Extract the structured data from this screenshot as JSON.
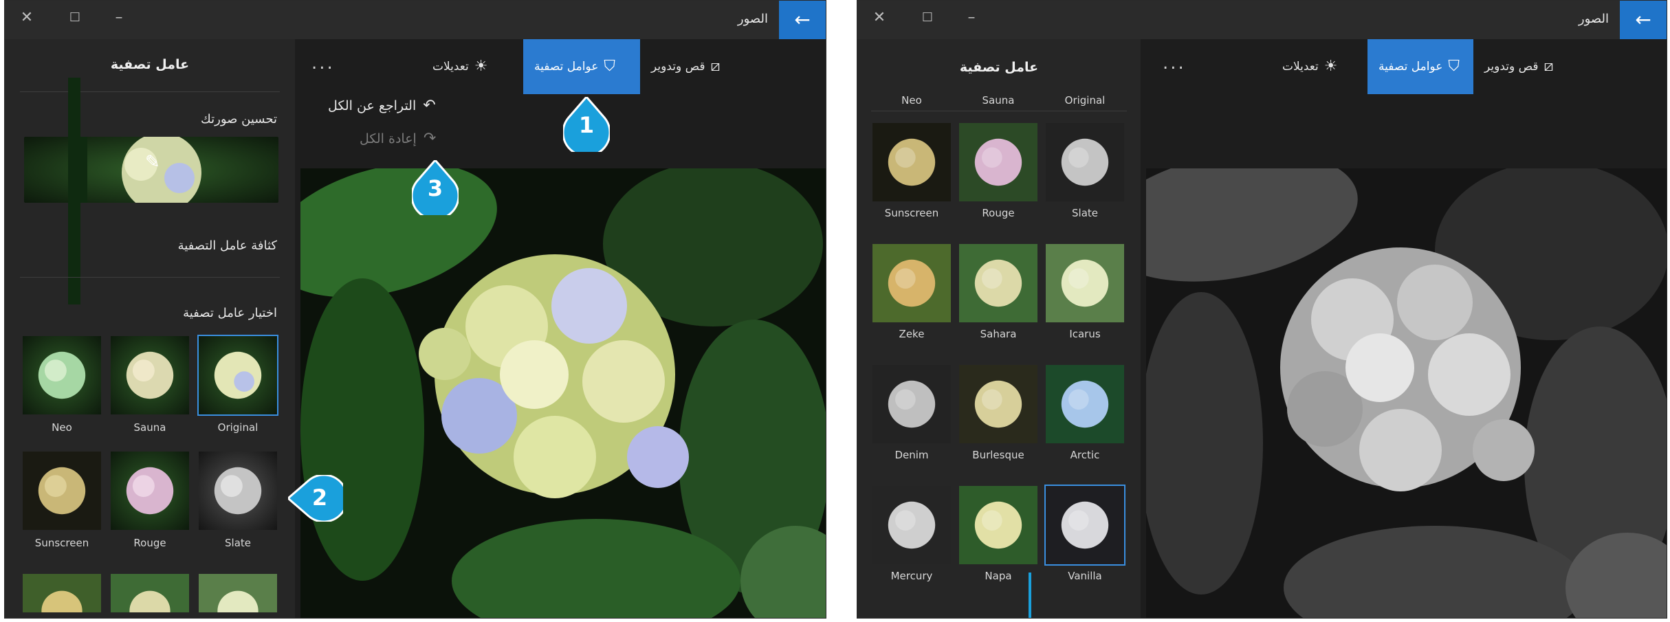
{
  "windowA": {
    "title": "الصور",
    "back_icon": "back-arrow-icon",
    "toolbar": {
      "crop_label": "قص وتدوير",
      "filters_label": "عوامل تصفية",
      "adjust_label": "تعديلات",
      "more_label": "..."
    },
    "undo_all": "التراجع عن الكل",
    "redo_all": "إعادة الكل",
    "panel": {
      "title": "عامل تصفية",
      "enhance_label": "تحسين صورتك",
      "intensity_label": "كثافة عامل التصفية",
      "choose_label": "اختيار عامل تصفية",
      "filters_row1": [
        "Neo",
        "Sauna",
        "Original"
      ],
      "filters_row2": [
        "Sunscreen",
        "Rouge",
        "Slate"
      ],
      "selected": "Original"
    },
    "callouts": [
      "1",
      "2",
      "3"
    ]
  },
  "windowB": {
    "title": "الصور",
    "back_icon": "back-arrow-icon",
    "toolbar": {
      "crop_label": "قص وتدوير",
      "filters_label": "عوامل تصفية",
      "adjust_label": "تعديلات",
      "more_label": "..."
    },
    "panel": {
      "title": "عامل تصفية",
      "header_row": [
        "Neo",
        "Sauna",
        "Original"
      ],
      "filters_row1": [
        "Sunscreen",
        "Rouge",
        "Slate"
      ],
      "filters_row2": [
        "Zeke",
        "Sahara",
        "Icarus"
      ],
      "filters_row3": [
        "Denim",
        "Burlesque",
        "Arctic"
      ],
      "filters_row4": [
        "Mercury",
        "Napa",
        "Vanilla"
      ],
      "selected": "Vanilla"
    }
  },
  "colors": {
    "accent": "#2b7bd0",
    "callout": "#1aa0dc",
    "window_bg": "#1d1d1d",
    "panel_bg": "#262626"
  }
}
